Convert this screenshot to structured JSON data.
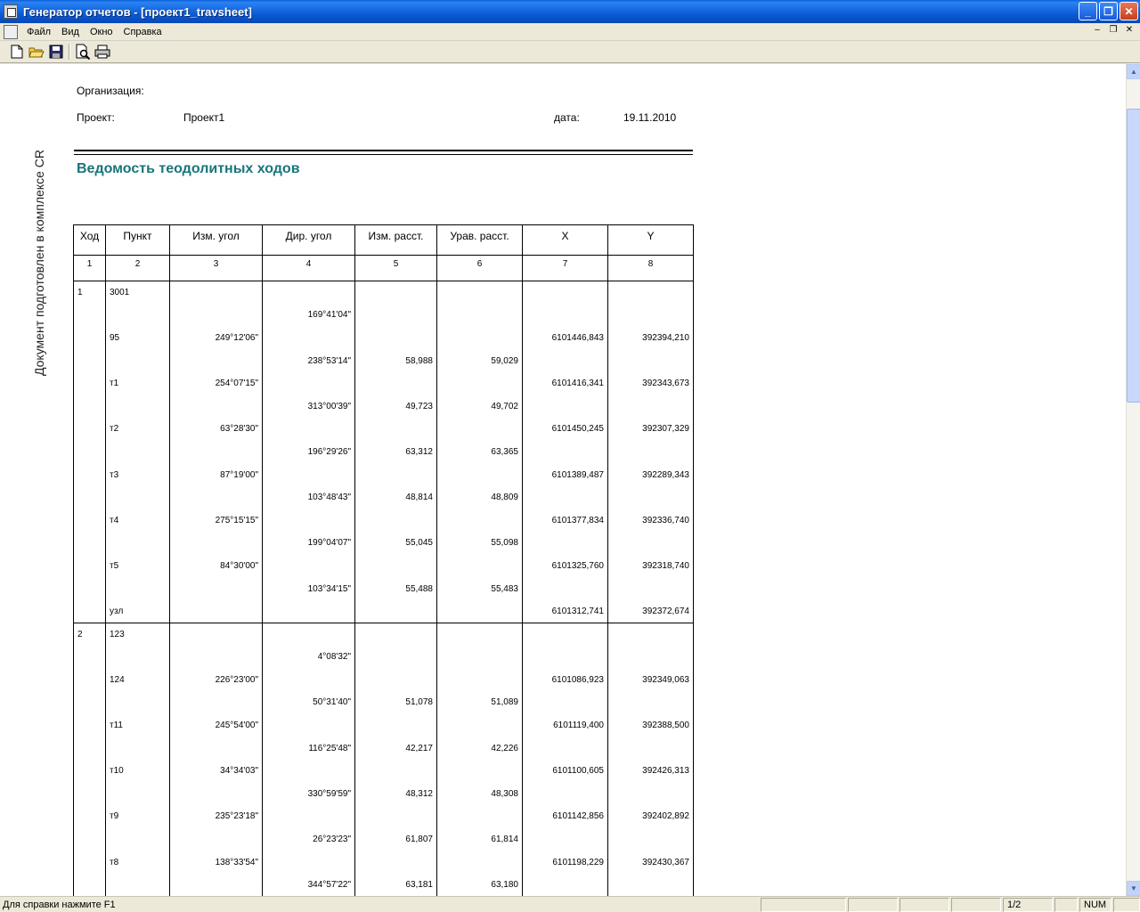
{
  "window": {
    "title": "Генератор отчетов - [проект1_travsheet]"
  },
  "menu": [
    "Файл",
    "Вид",
    "Окно",
    "Справка"
  ],
  "toolbar": {
    "icons": [
      "new-icon",
      "open-icon",
      "save-icon",
      "print-preview-icon",
      "print-icon"
    ]
  },
  "side_text": "Документ подготовлен в комплексе CR",
  "info": {
    "org_label": "Организация:",
    "project_label": "Проект:",
    "project_value": "Проект1",
    "date_label": "дата:",
    "date_value": "19.11.2010"
  },
  "report_title": "Ведомость теодолитных ходов",
  "table": {
    "headers": [
      "Ход",
      "Пункт",
      "Изм. угол",
      "Дир. угол",
      "Изм. расст.",
      "Урав. расст.",
      "X",
      "Y"
    ],
    "col_numbers": [
      "1",
      "2",
      "3",
      "4",
      "5",
      "6",
      "7",
      "8"
    ],
    "rows": [
      [
        "1",
        "3001",
        "",
        "",
        "",
        "",
        "",
        ""
      ],
      [
        "",
        "",
        "",
        "169°41'04\"",
        "",
        "",
        "",
        ""
      ],
      [
        "",
        "95",
        "249°12'06\"",
        "",
        "",
        "",
        "6101446,843",
        "392394,210"
      ],
      [
        "",
        "",
        "",
        "238°53'14\"",
        "58,988",
        "59,029",
        "",
        ""
      ],
      [
        "",
        "т1",
        "254°07'15\"",
        "",
        "",
        "",
        "6101416,341",
        "392343,673"
      ],
      [
        "",
        "",
        "",
        "313°00'39\"",
        "49,723",
        "49,702",
        "",
        ""
      ],
      [
        "",
        "т2",
        "63°28'30\"",
        "",
        "",
        "",
        "6101450,245",
        "392307,329"
      ],
      [
        "",
        "",
        "",
        "196°29'26\"",
        "63,312",
        "63,365",
        "",
        ""
      ],
      [
        "",
        "т3",
        "87°19'00\"",
        "",
        "",
        "",
        "6101389,487",
        "392289,343"
      ],
      [
        "",
        "",
        "",
        "103°48'43\"",
        "48,814",
        "48,809",
        "",
        ""
      ],
      [
        "",
        "т4",
        "275°15'15\"",
        "",
        "",
        "",
        "6101377,834",
        "392336,740"
      ],
      [
        "",
        "",
        "",
        "199°04'07\"",
        "55,045",
        "55,098",
        "",
        ""
      ],
      [
        "",
        "т5",
        "84°30'00\"",
        "",
        "",
        "",
        "6101325,760",
        "392318,740"
      ],
      [
        "",
        "",
        "",
        "103°34'15\"",
        "55,488",
        "55,483",
        "",
        ""
      ],
      [
        "",
        "узл",
        "",
        "",
        "",
        "",
        "6101312,741",
        "392372,674"
      ],
      [
        "2",
        "123",
        "",
        "",
        "",
        "",
        "",
        ""
      ],
      [
        "",
        "",
        "",
        "4°08'32\"",
        "",
        "",
        "",
        ""
      ],
      [
        "",
        "124",
        "226°23'00\"",
        "",
        "",
        "",
        "6101086,923",
        "392349,063"
      ],
      [
        "",
        "",
        "",
        "50°31'40\"",
        "51,078",
        "51,089",
        "",
        ""
      ],
      [
        "",
        "т11",
        "245°54'00\"",
        "",
        "",
        "",
        "6101119,400",
        "392388,500"
      ],
      [
        "",
        "",
        "",
        "116°25'48\"",
        "42,217",
        "42,226",
        "",
        ""
      ],
      [
        "",
        "т10",
        "34°34'03\"",
        "",
        "",
        "",
        "6101100,605",
        "392426,313"
      ],
      [
        "",
        "",
        "",
        "330°59'59\"",
        "48,312",
        "48,308",
        "",
        ""
      ],
      [
        "",
        "т9",
        "235°23'18\"",
        "",
        "",
        "",
        "6101142,856",
        "392402,892"
      ],
      [
        "",
        "",
        "",
        "26°23'23\"",
        "61,807",
        "61,814",
        "",
        ""
      ],
      [
        "",
        "т8",
        "138°33'54\"",
        "",
        "",
        "",
        "6101198,229",
        "392430,367"
      ],
      [
        "",
        "",
        "",
        "344°57'22\"",
        "63,181",
        "63,180",
        "",
        ""
      ]
    ],
    "group_start_rows": [
      0,
      15
    ]
  },
  "status": {
    "message": "Для справки нажмите F1",
    "page": "1/2",
    "num": "NUM"
  }
}
